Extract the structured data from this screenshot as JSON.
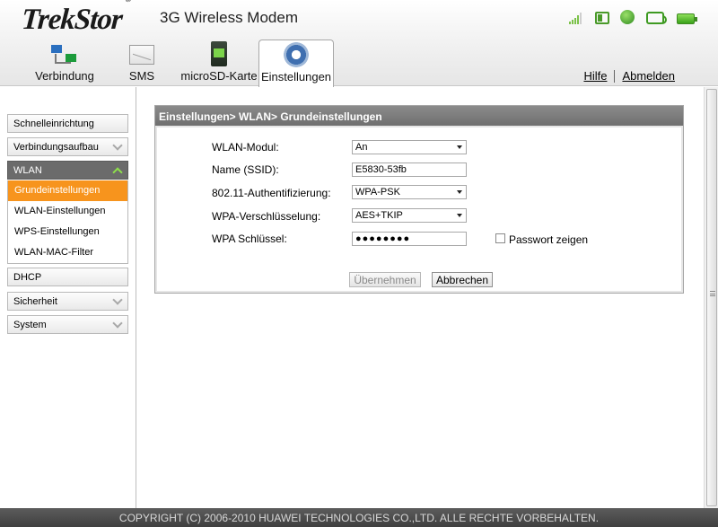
{
  "header": {
    "logo": "TrekStor",
    "logo_mark": "®",
    "title": "3G Wireless Modem",
    "status_icons": [
      "signal-strength-icon",
      "sim-card-icon",
      "globe-icon",
      "wifi-icon",
      "battery-icon"
    ],
    "help": "Hilfe",
    "logout": "Abmelden"
  },
  "tabs": [
    {
      "label": "Verbindung",
      "icon": "connection-icon"
    },
    {
      "label": "SMS",
      "icon": "envelope-icon"
    },
    {
      "label": "microSD-Karte",
      "icon": "sd-card-icon"
    },
    {
      "label": "Einstellungen",
      "icon": "gear-icon",
      "active": true
    }
  ],
  "sidebar": {
    "items": [
      {
        "label": "Schnelleinrichtung"
      },
      {
        "label": "Verbindungsaufbau"
      },
      {
        "label": "WLAN",
        "open": true
      },
      {
        "label": "DHCP"
      },
      {
        "label": "Sicherheit"
      },
      {
        "label": "System"
      }
    ],
    "wlan_sub": [
      {
        "label": "Grundeinstellungen",
        "active": true
      },
      {
        "label": "WLAN-Einstellungen"
      },
      {
        "label": "WPS-Einstellungen"
      },
      {
        "label": "WLAN-MAC-Filter"
      }
    ]
  },
  "panel": {
    "breadcrumb": "Einstellungen> WLAN> Grundeinstellungen",
    "fields": {
      "wlan_module": {
        "label": "WLAN-Modul:",
        "value": "An"
      },
      "ssid": {
        "label": "Name (SSID):",
        "value": "E5830-53fb"
      },
      "auth": {
        "label": "802.11-Authentifizierung:",
        "value": "WPA-PSK"
      },
      "encryption": {
        "label": "WPA-Verschlüsselung:",
        "value": "AES+TKIP"
      },
      "key": {
        "label": "WPA Schlüssel:",
        "value": "●●●●●●●●"
      }
    },
    "show_password": "Passwort zeigen",
    "apply": "Übernehmen",
    "cancel": "Abbrechen"
  },
  "footer": "COPYRIGHT (C) 2006-2010 HUAWEI TECHNOLOGIES CO.,LTD. ALLE RECHTE VORBEHALTEN.",
  "colors": {
    "accent": "#f7941d",
    "header_bar": "#787878",
    "active_menu": "#6b6b6b",
    "status_green": "#4a9a2a"
  }
}
